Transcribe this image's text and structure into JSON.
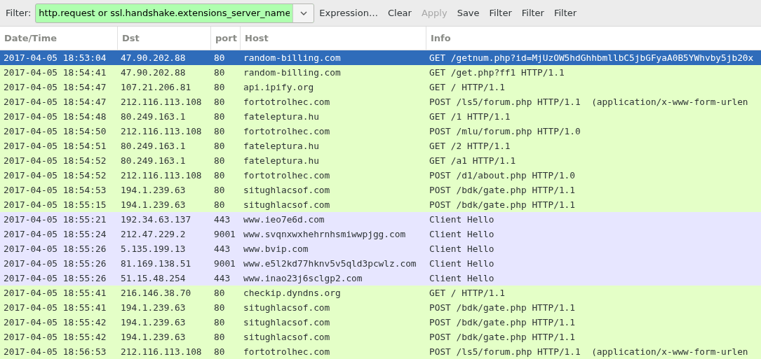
{
  "toolbar": {
    "label": "Filter:",
    "filter_value": "http.request or ssl.handshake.extensions_server_name",
    "valid": true,
    "buttons": [
      {
        "label": "Expression…",
        "disabled": false
      },
      {
        "label": "Clear",
        "disabled": false
      },
      {
        "label": "Apply",
        "disabled": true
      },
      {
        "label": "Save",
        "disabled": false
      },
      {
        "label": "Filter",
        "disabled": false
      },
      {
        "label": "Filter",
        "disabled": false
      },
      {
        "label": "Filter",
        "disabled": false
      }
    ]
  },
  "table": {
    "columns": [
      "Date/Time",
      "Dst",
      "port",
      "Host",
      "Info"
    ],
    "rows": [
      {
        "selected": true,
        "cells": [
          "2017-04-05 18:53:04",
          "47.90.202.88",
          "80",
          "random-billing.com",
          "GET /getnum.php?id=MjUzOW5hdGhhbmllbC5jbGFyaA0B5YWhvby5jb20x"
        ]
      },
      {
        "kind": "http",
        "selected": false,
        "cells": [
          "2017-04-05 18:54:41",
          "47.90.202.88",
          "80",
          "random-billing.com",
          "GET /get.php?ff1 HTTP/1.1"
        ]
      },
      {
        "kind": "http",
        "selected": false,
        "cells": [
          "2017-04-05 18:54:47",
          "107.21.206.81",
          "80",
          "api.ipify.org",
          "GET / HTTP/1.1"
        ]
      },
      {
        "kind": "http",
        "selected": false,
        "cells": [
          "2017-04-05 18:54:47",
          "212.116.113.108",
          "80",
          "fortotrolhec.com",
          "POST /ls5/forum.php HTTP/1.1  (application/x-www-form-urlen"
        ]
      },
      {
        "kind": "http",
        "selected": false,
        "cells": [
          "2017-04-05 18:54:48",
          "80.249.163.1",
          "80",
          "fateleptura.hu",
          "GET /1 HTTP/1.1"
        ]
      },
      {
        "kind": "http",
        "selected": false,
        "cells": [
          "2017-04-05 18:54:50",
          "212.116.113.108",
          "80",
          "fortotrolhec.com",
          "POST /mlu/forum.php HTTP/1.0"
        ]
      },
      {
        "kind": "http",
        "selected": false,
        "cells": [
          "2017-04-05 18:54:51",
          "80.249.163.1",
          "80",
          "fateleptura.hu",
          "GET /2 HTTP/1.1"
        ]
      },
      {
        "kind": "http",
        "selected": false,
        "cells": [
          "2017-04-05 18:54:52",
          "80.249.163.1",
          "80",
          "fateleptura.hu",
          "GET /a1 HTTP/1.1"
        ]
      },
      {
        "kind": "http",
        "selected": false,
        "cells": [
          "2017-04-05 18:54:52",
          "212.116.113.108",
          "80",
          "fortotrolhec.com",
          "POST /d1/about.php HTTP/1.0"
        ]
      },
      {
        "kind": "http",
        "selected": false,
        "cells": [
          "2017-04-05 18:54:53",
          "194.1.239.63",
          "80",
          "situghlacsof.com",
          "POST /bdk/gate.php HTTP/1.1"
        ]
      },
      {
        "kind": "http",
        "selected": false,
        "cells": [
          "2017-04-05 18:55:15",
          "194.1.239.63",
          "80",
          "situghlacsof.com",
          "POST /bdk/gate.php HTTP/1.1"
        ]
      },
      {
        "kind": "tls",
        "selected": false,
        "cells": [
          "2017-04-05 18:55:21",
          "192.34.63.137",
          "443",
          "www.ieo7e6d.com",
          "Client Hello"
        ]
      },
      {
        "kind": "tls",
        "selected": false,
        "cells": [
          "2017-04-05 18:55:24",
          "212.47.229.2",
          "9001",
          "www.svqnxwxhehrnhsmiwwpjgg.com",
          "Client Hello"
        ]
      },
      {
        "kind": "tls",
        "selected": false,
        "cells": [
          "2017-04-05 18:55:26",
          "5.135.199.13",
          "443",
          "www.bvip.com",
          "Client Hello"
        ]
      },
      {
        "kind": "tls",
        "selected": false,
        "cells": [
          "2017-04-05 18:55:26",
          "81.169.138.51",
          "9001",
          "www.e5l2kd77hknv5v5qld3pcwlz.com",
          "Client Hello"
        ]
      },
      {
        "kind": "tls",
        "selected": false,
        "cells": [
          "2017-04-05 18:55:26",
          "51.15.48.254",
          "443",
          "www.inao23j6sclgp2.com",
          "Client Hello"
        ]
      },
      {
        "kind": "http",
        "selected": false,
        "cells": [
          "2017-04-05 18:55:41",
          "216.146.38.70",
          "80",
          "checkip.dyndns.org",
          "GET / HTTP/1.1"
        ]
      },
      {
        "kind": "http",
        "selected": false,
        "cells": [
          "2017-04-05 18:55:41",
          "194.1.239.63",
          "80",
          "situghlacsof.com",
          "POST /bdk/gate.php HTTP/1.1"
        ]
      },
      {
        "kind": "http",
        "selected": false,
        "cells": [
          "2017-04-05 18:55:42",
          "194.1.239.63",
          "80",
          "situghlacsof.com",
          "POST /bdk/gate.php HTTP/1.1"
        ]
      },
      {
        "kind": "http",
        "selected": false,
        "cells": [
          "2017-04-05 18:55:42",
          "194.1.239.63",
          "80",
          "situghlacsof.com",
          "POST /bdk/gate.php HTTP/1.1"
        ]
      },
      {
        "kind": "http",
        "selected": false,
        "cells": [
          "2017-04-05 18:56:53",
          "212.116.113.108",
          "80",
          "fortotrolhec.com",
          "POST /ls5/forum.php HTTP/1.1  (application/x-www-form-urlen"
        ]
      }
    ]
  }
}
